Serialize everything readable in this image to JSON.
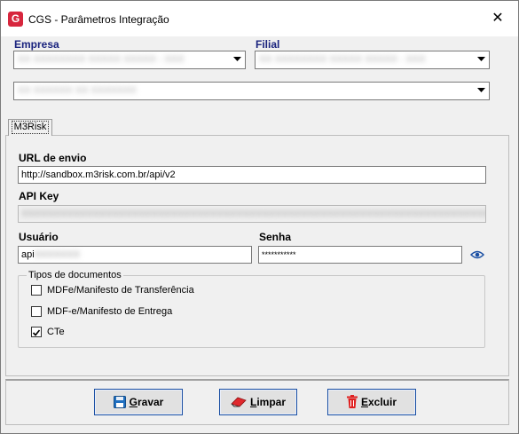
{
  "window": {
    "title": "CGS - Parâmetros Integração"
  },
  "filters": {
    "empresa_label": "Empresa",
    "filial_label": "Filial",
    "empresa_value": "XX XXXXXXXX XXXXX XXXXX - XXX",
    "filial_value": "XX XXXXXXXX XXXXX XXXXX - XXX",
    "third_value": "XX XXXXXX XX XXXXXXX"
  },
  "tabs": [
    {
      "label": "M3Risk"
    }
  ],
  "form": {
    "url_label": "URL de envio",
    "url_value": "http://sandbox.m3risk.com.br/api/v2",
    "apikey_label": "API Key",
    "apikey_value": "XXXXXXXXXXXXXXXXXXXXXXXXXXXXXXXXXXXXXXXXXXXXXXXXXXXXXXXXXXXXXXXXXXXXXXXX",
    "usuario_label": "Usuário",
    "usuario_value": "api",
    "usuario_hidden": "XXXXXXX",
    "senha_label": "Senha",
    "senha_value": "***********"
  },
  "doc_types": {
    "title": "Tipos de documentos",
    "items": [
      {
        "label": "MDFe/Manifesto de Transferência",
        "checked": false
      },
      {
        "label": "MDF-e/Manifesto de Entrega",
        "checked": false
      },
      {
        "label": "CTe",
        "checked": true
      }
    ]
  },
  "buttons": {
    "gravar_first": "G",
    "gravar_rest": "ravar",
    "limpar_first": "L",
    "limpar_rest": "impar",
    "excluir_first": "E",
    "excluir_rest": "xcluir"
  },
  "colors": {
    "label_blue": "#1a237e",
    "button_border": "#1a4fa3",
    "app_icon": "#d7263d",
    "excluir_icon": "#e02020",
    "limpar_icon": "#e0282d"
  },
  "icons": {
    "app": "cgs-logo-icon",
    "close": "close-icon",
    "eye": "eye-icon",
    "gravar": "floppy-disk-icon",
    "limpar": "eraser-icon",
    "excluir": "trash-icon"
  }
}
